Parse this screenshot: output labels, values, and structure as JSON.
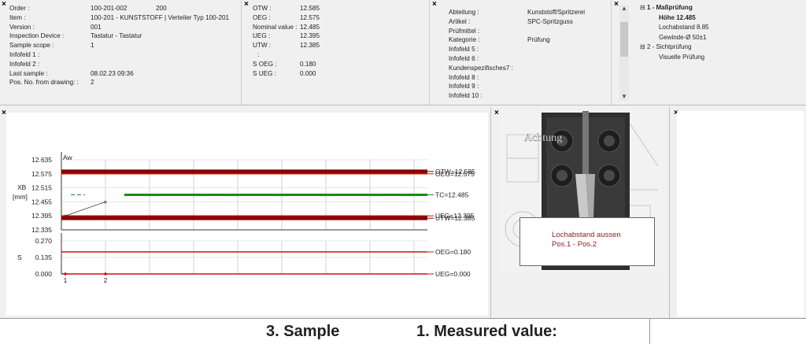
{
  "info1": [
    {
      "label": "Order :",
      "value": "100-201-002",
      "extra": "200"
    },
    {
      "label": "Item :",
      "value": "100-201 - KUNSTSTOFF | Verteiler Typ 100-201",
      "extra": ""
    },
    {
      "label": "Version :",
      "value": "001",
      "extra": ""
    },
    {
      "label": "Inspection Device :",
      "value": "Tastatur - Tastatur",
      "extra": ""
    },
    {
      "label": "Sample scope :",
      "value": "1",
      "extra": ""
    },
    {
      "label": "Infofeld 1 :",
      "value": "",
      "extra": ""
    },
    {
      "label": "Infofeld 2 :",
      "value": "",
      "extra": ""
    },
    {
      "label": "Last sample :",
      "value": "08.02.23 09:36",
      "extra": ""
    },
    {
      "label": "Pos. No. from drawing: :",
      "value": "2",
      "extra": ""
    }
  ],
  "info2": [
    {
      "label": "OTW :",
      "value": "12.585"
    },
    {
      "label": "OEG :",
      "value": "12.575"
    },
    {
      "label": "Nominal value :",
      "value": "12.485"
    },
    {
      "label": "UEG :",
      "value": "12.395"
    },
    {
      "label": "UTW :",
      "value": "12.385"
    },
    {
      "label": ":",
      "value": ""
    },
    {
      "label": "S OEG :",
      "value": "0.180"
    },
    {
      "label": "S UEG :",
      "value": "0.000"
    }
  ],
  "info3": [
    {
      "label": "Abteilung :",
      "value": "Kunststoff/Spritzerei"
    },
    {
      "label": "Artikel :",
      "value": "SPC-Spritzguss"
    },
    {
      "label": "Prüfmittel :",
      "value": ""
    },
    {
      "label": "Kategorie :",
      "value": "Prüfung"
    },
    {
      "label": "Infofeld 5 :",
      "value": ""
    },
    {
      "label": "Infofeld 6 :",
      "value": ""
    },
    {
      "label": "Kundenspezifisches7 :",
      "value": ""
    },
    {
      "label": "Infofeld 8 :",
      "value": ""
    },
    {
      "label": "Infofeld 9 :",
      "value": ""
    },
    {
      "label": "Infofeld 10 :",
      "value": ""
    }
  ],
  "tree": {
    "group1": "1 - Maßprüfung",
    "items1": [
      "Höhe 12.485",
      "Lochabstand 8.85",
      "Gewinde-Ø 50±1"
    ],
    "group2": "2 - Sichtprüfung",
    "items2": [
      "Visuelle Prüfung"
    ],
    "expander": "⊟"
  },
  "image": {
    "watermark": "Achtung",
    "callout_line1": "Lochabstand aussen",
    "callout_line2": "Pos.1 - Pos.2"
  },
  "bottom": {
    "sample": "3.  Sample",
    "measured": "1.  Measured value:"
  },
  "chart_data": [
    {
      "type": "line",
      "title": "",
      "ylabel": "XB [mm]",
      "xlabel": "",
      "corner_label": "Aw",
      "ylim": [
        12.335,
        12.635
      ],
      "yticks": [
        "12.635",
        "12.575",
        "12.515",
        "12.455",
        "12.395",
        "12.335"
      ],
      "xticks": [
        "1",
        "2"
      ],
      "x": [
        1,
        2
      ],
      "series": [
        {
          "name": "",
          "values": [
            12.395,
            12.455
          ]
        }
      ],
      "limits": [
        {
          "label": "OTW=12.585",
          "value": 12.585,
          "color": "#8b0000"
        },
        {
          "label": "OEG=12.575",
          "value": 12.575,
          "color": "#d01010"
        },
        {
          "label": "TC=12.485",
          "value": 12.485,
          "color": "#1a8a1a"
        },
        {
          "label": "UEG=12.395",
          "value": 12.395,
          "color": "#d01010"
        },
        {
          "label": "UTW=12.385",
          "value": 12.385,
          "color": "#8b0000"
        }
      ]
    },
    {
      "type": "line",
      "title": "",
      "ylabel": "S",
      "xlabel": "",
      "ylim": [
        0.0,
        0.27
      ],
      "yticks": [
        "0.270",
        "0.135",
        "0.000"
      ],
      "xticks": [
        "1",
        "2"
      ],
      "x": [
        1,
        2
      ],
      "series": [
        {
          "name": "",
          "values": [
            0.0,
            0.0
          ]
        }
      ],
      "limits": [
        {
          "label": "OEG=0.180",
          "value": 0.18,
          "color": "#d01010"
        },
        {
          "label": "UEG=0.000",
          "value": 0.0,
          "color": "#d01010"
        }
      ]
    }
  ]
}
